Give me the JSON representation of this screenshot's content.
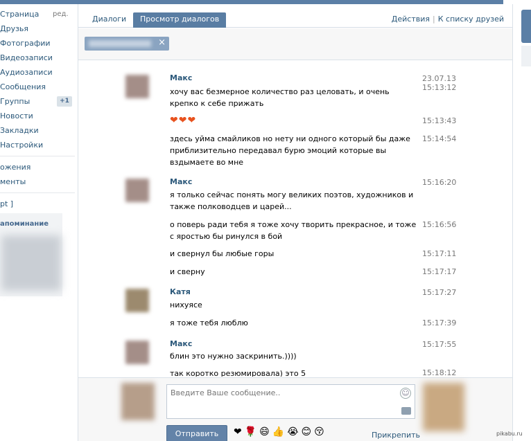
{
  "left_menu": {
    "items": [
      {
        "label": "Страница",
        "extra": "ред."
      },
      {
        "label": "Друзья"
      },
      {
        "label": "Фотографии"
      },
      {
        "label": "Видеозаписи"
      },
      {
        "label": "Аудиозаписи"
      },
      {
        "label": "Сообщения"
      },
      {
        "label": "Группы",
        "badge": "+1"
      },
      {
        "label": "Новости"
      },
      {
        "label": "Закладки"
      },
      {
        "label": "Настройки"
      }
    ],
    "items2": [
      "ожения",
      "менты"
    ],
    "items3": [
      "pt ]"
    ],
    "promo_title": "апоминание"
  },
  "tabs": {
    "dialogs": "Диалоги",
    "view": "Просмотр диалогов",
    "actions": "Действия",
    "to_friends": "К списку друзей"
  },
  "filter": {
    "clear": "×"
  },
  "messages": [
    {
      "name": "Макс",
      "text": "хочу вас безмерное количество раз целовать, и очень крепко к себе прижать",
      "date": "23.07.13",
      "time": "15:13:12"
    },
    {
      "text": "",
      "hearts": "❤❤❤",
      "time": "15:13:43"
    },
    {
      "text": "здесь уйма смайликов но нету ни одного который бы даже приблизительно передавал бурю эмоций которые вы вздымаете во мне",
      "time": "15:14:54"
    },
    {
      "name": "Макс",
      "text": "я только сейчас понять могу великих поэтов, художников и также полководцев и царей...",
      "time": "15:16:20"
    },
    {
      "text": "о поверь ради тебя я тоже хочу творить прекрасное, и тоже с яростью бы ринулся в бой",
      "time": "15:16:56"
    },
    {
      "text": "и свернул бы любые горы",
      "time": "15:17:11"
    },
    {
      "text": "и сверну",
      "time": "15:17:17"
    },
    {
      "name": "Катя",
      "text": "нихуясе",
      "time": "15:17:27"
    },
    {
      "text": "я тоже тебя люблю",
      "time": "15:17:39"
    },
    {
      "name": "Макс",
      "text": "блин это нужно заскринить.))))",
      "time": "15:17:55"
    },
    {
      "text": "так коротко резюмировала) это 5",
      "time": "15:18:12"
    }
  ],
  "compose": {
    "placeholder": "Введите Ваше сообщение..",
    "send": "Отправить",
    "emojis": "❤🌹😄👍😭😊😚",
    "attach": "Прикрепить"
  },
  "watermark": "pikabu.ru",
  "colors": {
    "accent": "#597da3",
    "link": "#2b587a"
  }
}
